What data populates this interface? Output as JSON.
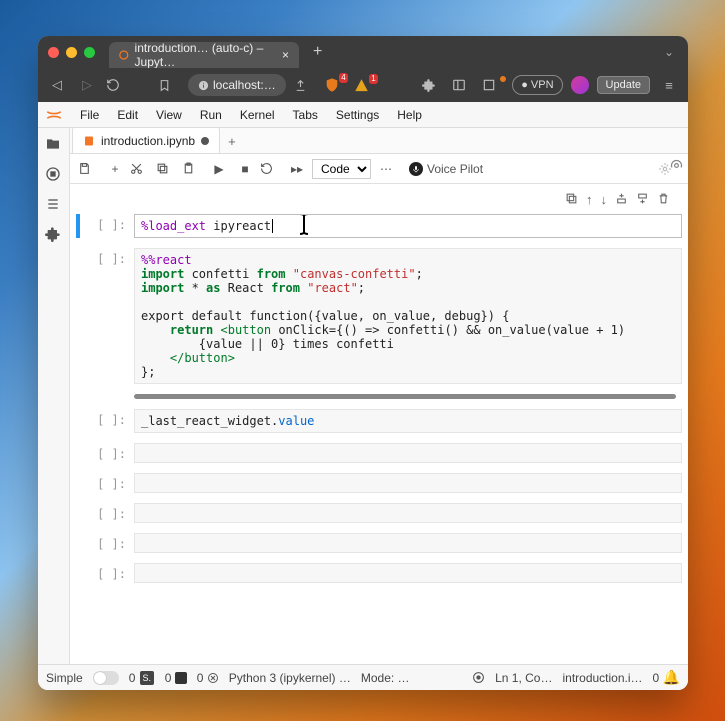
{
  "browser": {
    "tab_title": "introduction… (auto-c) – Jupyt…",
    "plus": "+",
    "address": "localhost:…",
    "shield_badge": "4",
    "warn_badge": "1",
    "vpn": "VPN",
    "update": "Update"
  },
  "menu": {
    "items": [
      "File",
      "Edit",
      "View",
      "Run",
      "Kernel",
      "Tabs",
      "Settings",
      "Help"
    ]
  },
  "doc": {
    "tab": "introduction.ipynb",
    "new": "+"
  },
  "nbtoolbar": {
    "celltype": "Code",
    "voice": "Voice Pilot"
  },
  "cells": [
    {
      "prompt": "[  ]:",
      "active": true,
      "raw": "%load_ext ipyreact",
      "html": "<span class='tok-mag'>%load_ext</span> ipyreact<span style='border-left:1px solid #000;margin-left:1px;'></span>"
    },
    {
      "prompt": "[  ]:",
      "html": "<span class='tok-mag'>%%react</span>\n<span class='tok-kw'>import</span> confetti <span class='tok-kw'>from</span> <span class='tok-str'>\"canvas-confetti\"</span>;\n<span class='tok-kw'>import</span> * <span class='tok-kw'>as</span> React <span class='tok-kw'>from</span> <span class='tok-str'>\"react\"</span>;\n\nexport default function({value, on_value, debug}) {\n    <span class='tok-kw'>return</span> <span class='tok-tag'>&lt;button</span> <span class='tok-fn'>onClick</span>={() =&gt; confetti() &amp;&amp; on_value(value + 1)\n        {value || 0} times confetti\n    <span class='tok-tag'>&lt;/button&gt;</span>\n};",
      "scroll": true
    },
    {
      "prompt": "[  ]:",
      "html": "_last_react_widget.<span class='tok-attr'>value</span>"
    },
    {
      "prompt": "[  ]:",
      "html": ""
    },
    {
      "prompt": "[  ]:",
      "html": ""
    },
    {
      "prompt": "[  ]:",
      "html": ""
    },
    {
      "prompt": "[  ]:",
      "html": ""
    },
    {
      "prompt": "[  ]:",
      "html": ""
    }
  ],
  "celltoolbar": {
    "icons": [
      "copy",
      "up",
      "down",
      "insert-above",
      "insert-below",
      "delete"
    ]
  },
  "status": {
    "simple": "Simple",
    "kernel": "Python 3 (ipykernel) …",
    "mode": "Mode: …",
    "ln": "Ln 1, Co…",
    "file": "introduction.i…",
    "save_count": "0",
    "term_count": "0",
    "err_count": "0",
    "bell_count": "0"
  }
}
